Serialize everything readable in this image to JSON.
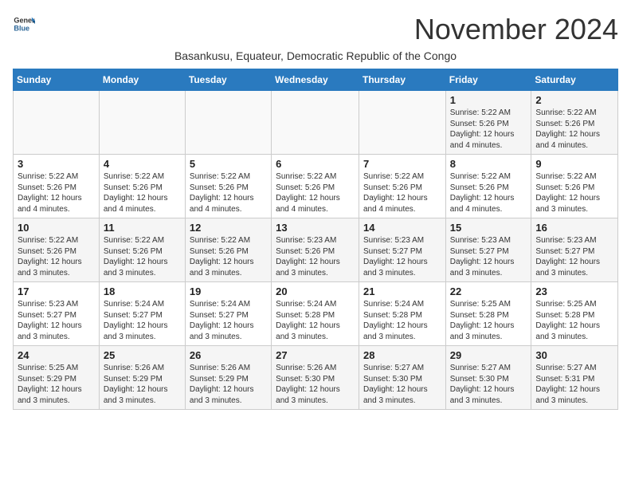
{
  "logo": {
    "general": "General",
    "blue": "Blue"
  },
  "header": {
    "month": "November 2024",
    "location": "Basankusu, Equateur, Democratic Republic of the Congo"
  },
  "weekdays": [
    "Sunday",
    "Monday",
    "Tuesday",
    "Wednesday",
    "Thursday",
    "Friday",
    "Saturday"
  ],
  "weeks": [
    [
      {
        "day": "",
        "info": ""
      },
      {
        "day": "",
        "info": ""
      },
      {
        "day": "",
        "info": ""
      },
      {
        "day": "",
        "info": ""
      },
      {
        "day": "",
        "info": ""
      },
      {
        "day": "1",
        "info": "Sunrise: 5:22 AM\nSunset: 5:26 PM\nDaylight: 12 hours and 4 minutes."
      },
      {
        "day": "2",
        "info": "Sunrise: 5:22 AM\nSunset: 5:26 PM\nDaylight: 12 hours and 4 minutes."
      }
    ],
    [
      {
        "day": "3",
        "info": "Sunrise: 5:22 AM\nSunset: 5:26 PM\nDaylight: 12 hours and 4 minutes."
      },
      {
        "day": "4",
        "info": "Sunrise: 5:22 AM\nSunset: 5:26 PM\nDaylight: 12 hours and 4 minutes."
      },
      {
        "day": "5",
        "info": "Sunrise: 5:22 AM\nSunset: 5:26 PM\nDaylight: 12 hours and 4 minutes."
      },
      {
        "day": "6",
        "info": "Sunrise: 5:22 AM\nSunset: 5:26 PM\nDaylight: 12 hours and 4 minutes."
      },
      {
        "day": "7",
        "info": "Sunrise: 5:22 AM\nSunset: 5:26 PM\nDaylight: 12 hours and 4 minutes."
      },
      {
        "day": "8",
        "info": "Sunrise: 5:22 AM\nSunset: 5:26 PM\nDaylight: 12 hours and 4 minutes."
      },
      {
        "day": "9",
        "info": "Sunrise: 5:22 AM\nSunset: 5:26 PM\nDaylight: 12 hours and 3 minutes."
      }
    ],
    [
      {
        "day": "10",
        "info": "Sunrise: 5:22 AM\nSunset: 5:26 PM\nDaylight: 12 hours and 3 minutes."
      },
      {
        "day": "11",
        "info": "Sunrise: 5:22 AM\nSunset: 5:26 PM\nDaylight: 12 hours and 3 minutes."
      },
      {
        "day": "12",
        "info": "Sunrise: 5:22 AM\nSunset: 5:26 PM\nDaylight: 12 hours and 3 minutes."
      },
      {
        "day": "13",
        "info": "Sunrise: 5:23 AM\nSunset: 5:26 PM\nDaylight: 12 hours and 3 minutes."
      },
      {
        "day": "14",
        "info": "Sunrise: 5:23 AM\nSunset: 5:27 PM\nDaylight: 12 hours and 3 minutes."
      },
      {
        "day": "15",
        "info": "Sunrise: 5:23 AM\nSunset: 5:27 PM\nDaylight: 12 hours and 3 minutes."
      },
      {
        "day": "16",
        "info": "Sunrise: 5:23 AM\nSunset: 5:27 PM\nDaylight: 12 hours and 3 minutes."
      }
    ],
    [
      {
        "day": "17",
        "info": "Sunrise: 5:23 AM\nSunset: 5:27 PM\nDaylight: 12 hours and 3 minutes."
      },
      {
        "day": "18",
        "info": "Sunrise: 5:24 AM\nSunset: 5:27 PM\nDaylight: 12 hours and 3 minutes."
      },
      {
        "day": "19",
        "info": "Sunrise: 5:24 AM\nSunset: 5:27 PM\nDaylight: 12 hours and 3 minutes."
      },
      {
        "day": "20",
        "info": "Sunrise: 5:24 AM\nSunset: 5:28 PM\nDaylight: 12 hours and 3 minutes."
      },
      {
        "day": "21",
        "info": "Sunrise: 5:24 AM\nSunset: 5:28 PM\nDaylight: 12 hours and 3 minutes."
      },
      {
        "day": "22",
        "info": "Sunrise: 5:25 AM\nSunset: 5:28 PM\nDaylight: 12 hours and 3 minutes."
      },
      {
        "day": "23",
        "info": "Sunrise: 5:25 AM\nSunset: 5:28 PM\nDaylight: 12 hours and 3 minutes."
      }
    ],
    [
      {
        "day": "24",
        "info": "Sunrise: 5:25 AM\nSunset: 5:29 PM\nDaylight: 12 hours and 3 minutes."
      },
      {
        "day": "25",
        "info": "Sunrise: 5:26 AM\nSunset: 5:29 PM\nDaylight: 12 hours and 3 minutes."
      },
      {
        "day": "26",
        "info": "Sunrise: 5:26 AM\nSunset: 5:29 PM\nDaylight: 12 hours and 3 minutes."
      },
      {
        "day": "27",
        "info": "Sunrise: 5:26 AM\nSunset: 5:30 PM\nDaylight: 12 hours and 3 minutes."
      },
      {
        "day": "28",
        "info": "Sunrise: 5:27 AM\nSunset: 5:30 PM\nDaylight: 12 hours and 3 minutes."
      },
      {
        "day": "29",
        "info": "Sunrise: 5:27 AM\nSunset: 5:30 PM\nDaylight: 12 hours and 3 minutes."
      },
      {
        "day": "30",
        "info": "Sunrise: 5:27 AM\nSunset: 5:31 PM\nDaylight: 12 hours and 3 minutes."
      }
    ]
  ]
}
